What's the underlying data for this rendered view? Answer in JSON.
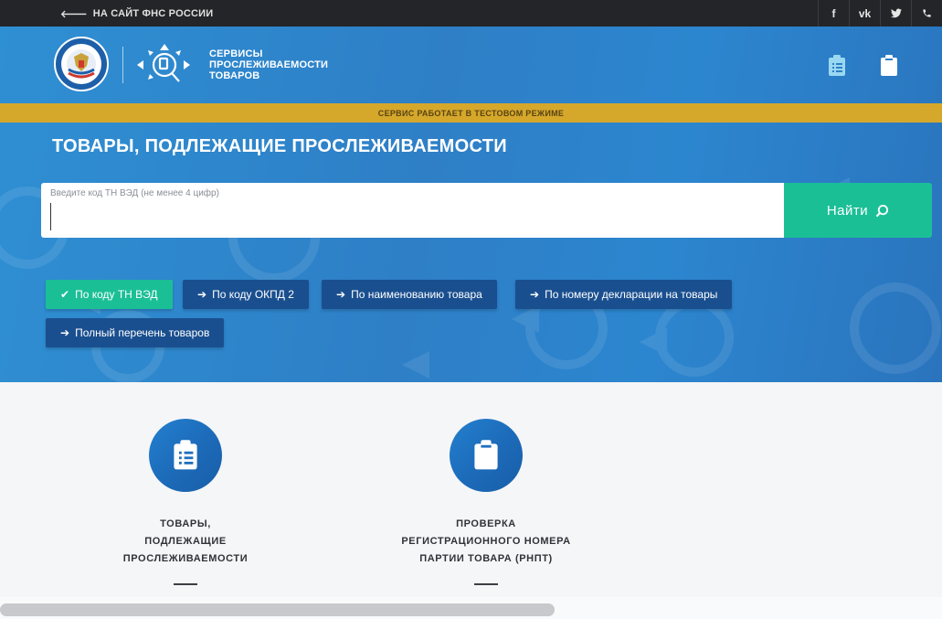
{
  "topbar": {
    "back_link": "НА САЙТ ФНС РОССИИ",
    "social": [
      {
        "icon": "facebook-icon",
        "glyph": "f"
      },
      {
        "icon": "vk-icon",
        "glyph": "vk"
      },
      {
        "icon": "twitter-icon",
        "glyph": "🐦"
      },
      {
        "icon": "phone-icon",
        "glyph": "✆"
      }
    ]
  },
  "brand": {
    "line1": "СЕРВИСЫ",
    "line2": "ПРОСЛЕЖИВАЕМОСТИ",
    "line3": "ТОВАРОВ"
  },
  "banner": "СЕРВИС РАБОТАЕТ В ТЕСТОВОМ РЕЖИМЕ",
  "page_title": "ТОВАРЫ, ПОДЛЕЖАЩИЕ ПРОСЛЕЖИВАЕМОСТИ",
  "search": {
    "label": "Введите код ТН ВЭД (не менее 4 цифр)",
    "value": "",
    "button": "Найти"
  },
  "filters": [
    {
      "label": "По коду ТН ВЭД",
      "active": true
    },
    {
      "label": "По коду ОКПД 2",
      "active": false
    },
    {
      "label": "По наименованию товара",
      "active": false
    },
    {
      "label": "По номеру декларации на товары",
      "active": false
    },
    {
      "label": "Полный перечень товаров",
      "active": false
    }
  ],
  "features": [
    {
      "line1": "ТОВАРЫ,",
      "line2": "ПОДЛЕЖАЩИЕ",
      "line3": "ПРОСЛЕЖИВАЕМОСТИ",
      "icon": "clipboard-list-icon"
    },
    {
      "line1": "ПРОВЕРКА",
      "line2": "РЕГИСТРАЦИОННОГО НОМЕРА",
      "line3": "ПАРТИИ ТОВАРА (РНПТ)",
      "icon": "clipboard-icon"
    }
  ],
  "colors": {
    "hero_blue": "#2e7fc6",
    "banner_gold": "#d5a82b",
    "accent_green": "#1bbf96",
    "button_navy": "#1a4f8f"
  }
}
